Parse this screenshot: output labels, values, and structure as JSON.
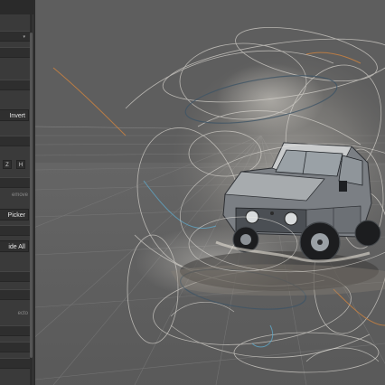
{
  "panel": {
    "invert_label": "Invert",
    "axis_z": "Z",
    "axis_h": "H",
    "remove_label": "emove",
    "picker_label": "Picker",
    "hide_all_label": "ide All",
    "vector_label": "ecto"
  },
  "viewport": {
    "subject": "off-road vehicle in abstract line-art swirl"
  },
  "colors": {
    "panel_bg": "#3a3a3a",
    "viewport_bg": "#5c5c5c",
    "accent_orange": "#d9873c",
    "accent_blue": "#5fa8c8"
  }
}
